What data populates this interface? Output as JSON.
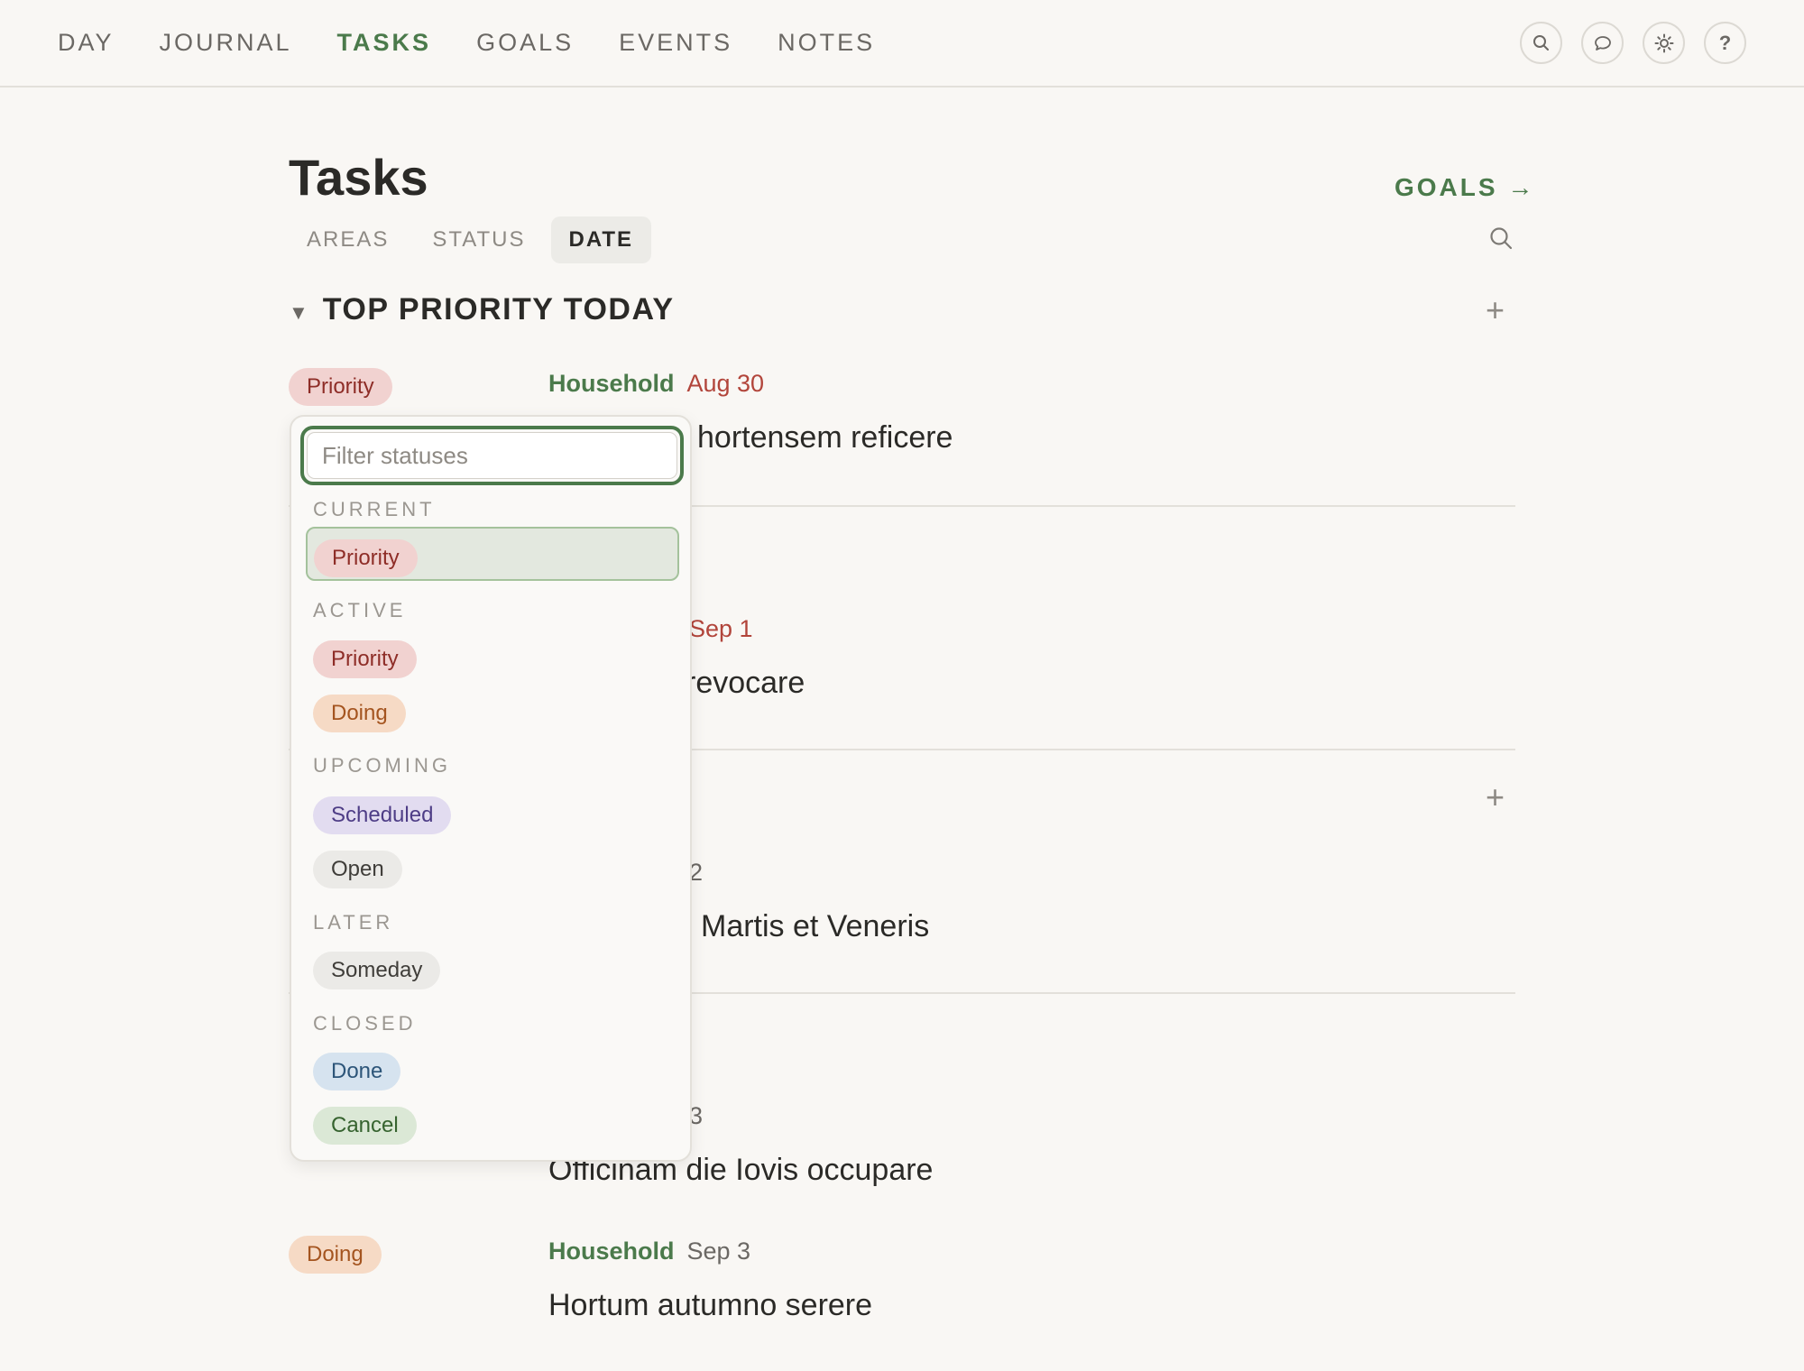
{
  "nav": {
    "links": [
      "DAY",
      "JOURNAL",
      "TASKS",
      "GOALS",
      "EVENTS",
      "NOTES"
    ],
    "active": "TASKS",
    "icons": [
      "search-icon",
      "chat-icon",
      "sun-icon",
      "help-icon"
    ],
    "help_glyph": "?"
  },
  "header": {
    "title": "Tasks",
    "goals_link": "GOALS →",
    "tabs": [
      "AREAS",
      "STATUS",
      "DATE"
    ],
    "active_tab": "DATE"
  },
  "section": {
    "title": "TOP PRIORITY TODAY",
    "caret": "▼",
    "add": "+"
  },
  "tasks": [
    {
      "status": "Priority",
      "area": "Household",
      "date": "Aug 30",
      "title": "hortensem reficere"
    },
    {
      "status": "",
      "area": "",
      "date": "Sep 1",
      "title": "revocare"
    },
    {
      "status": "",
      "area": "",
      "date": "2",
      "title": "Martis et Veneris"
    },
    {
      "status": "",
      "area": "",
      "date": "3",
      "title": "Officinam die Iovis occupare"
    },
    {
      "status": "Doing",
      "area": "Household",
      "date": "Sep 3",
      "title": "Hortum autumno serere"
    }
  ],
  "dropdown": {
    "placeholder": "Filter statuses",
    "groups": {
      "current": {
        "label": "CURRENT",
        "items": [
          "Priority"
        ]
      },
      "active": {
        "label": "ACTIVE",
        "items": [
          "Priority",
          "Doing"
        ]
      },
      "upcoming": {
        "label": "UPCOMING",
        "items": [
          "Scheduled",
          "Open"
        ]
      },
      "later": {
        "label": "LATER",
        "items": [
          "Someday"
        ]
      },
      "closed": {
        "label": "CLOSED",
        "items": [
          "Done",
          "Cancel"
        ]
      }
    }
  },
  "colors": {
    "accent_green": "#4b7a4b",
    "date_red": "#b2453b",
    "background": "#f9f7f4"
  }
}
